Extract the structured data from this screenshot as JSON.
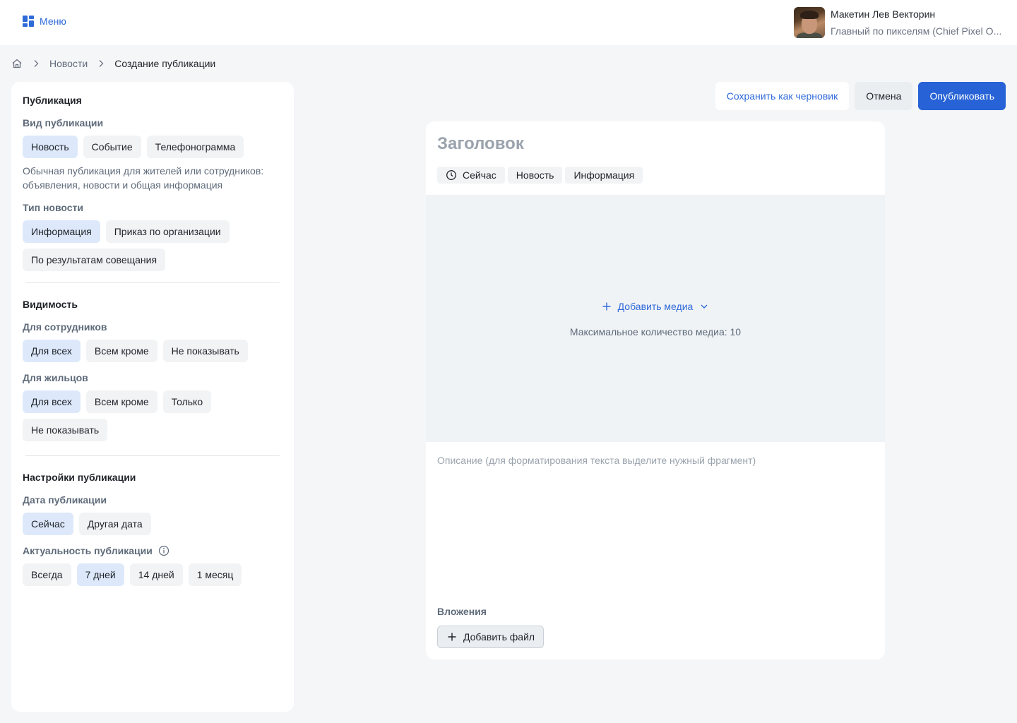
{
  "header": {
    "menu_label": "Меню",
    "user_name": "Макетин Лев Векторин",
    "user_role": "Главный по пикселям (Chief Pixel O..."
  },
  "breadcrumb": {
    "items": [
      "Новости"
    ],
    "current": "Создание публикации"
  },
  "actions": {
    "draft": "Сохранить как черновик",
    "cancel": "Отмена",
    "publish": "Опубликовать"
  },
  "sidebar": {
    "publication": {
      "title": "Публикация",
      "kind_label": "Вид публикации",
      "kinds": [
        "Новость",
        "Событие",
        "Телефонограмма"
      ],
      "kind_selected": "Новость",
      "kind_hint": "Обычная публикация для жителей или сотрудников: объявления, новости и общая информация",
      "type_label": "Тип новости",
      "types": [
        "Информация",
        "Приказ по организации",
        "По результатам совещания"
      ],
      "type_selected": "Информация"
    },
    "visibility": {
      "title": "Видимость",
      "employees_label": "Для сотрудников",
      "employees": [
        "Для всех",
        "Всем кроме",
        "Не показывать"
      ],
      "employees_selected": "Для всех",
      "residents_label": "Для жильцов",
      "residents": [
        "Для всех",
        "Всем кроме",
        "Только",
        "Не показывать"
      ],
      "residents_selected": "Для всех"
    },
    "settings": {
      "title": "Настройки публикации",
      "date_label": "Дата публикации",
      "dates": [
        "Сейчас",
        "Другая дата"
      ],
      "date_selected": "Сейчас",
      "relevance_label": "Актуальность публикации",
      "relevance": [
        "Всегда",
        "7 дней",
        "14 дней",
        "1 месяц"
      ],
      "relevance_selected": "7 дней"
    }
  },
  "editor": {
    "title_placeholder": "Заголовок",
    "tags": [
      "Сейчас",
      "Новость",
      "Информация"
    ],
    "add_media": "Добавить медиа",
    "media_limit": "Максимальное количество медиа: 10",
    "description_placeholder": "Описание (для форматирования текста выделите нужный фрагмент)",
    "attachments_label": "Вложения",
    "add_file": "Добавить файл"
  },
  "colors": {
    "accent": "#2763d6",
    "chip_active": "#dde9fb",
    "chip": "#f1f3f5",
    "background": "#f5f6f8"
  }
}
